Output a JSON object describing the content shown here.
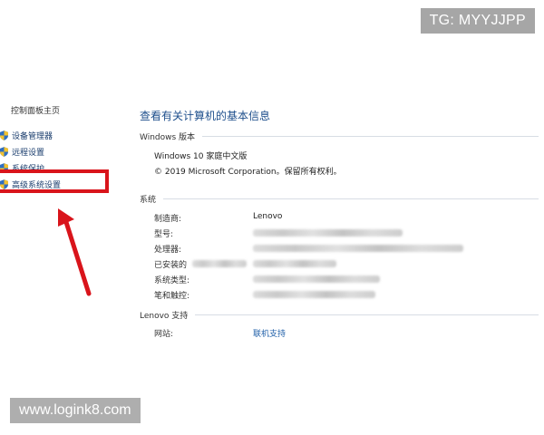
{
  "watermarks": {
    "top": "TG: MYYJJPP",
    "bottom": "www.logink8.com"
  },
  "nav": {
    "title": "控制面板主页",
    "items": [
      {
        "label": "设备管理器",
        "icon": "shield-icon"
      },
      {
        "label": "远程设置",
        "icon": "shield-icon"
      },
      {
        "label": "系统保护",
        "icon": "shield-icon"
      },
      {
        "label": "高级系统设置",
        "icon": "shield-icon"
      }
    ]
  },
  "highlight": {
    "box_color": "#d9141b",
    "arrow_color": "#d9141b"
  },
  "main": {
    "title": "查看有关计算机的基本信息",
    "windows_section": {
      "header": "Windows 版本",
      "edition": "Windows 10 家庭中文版",
      "copyright": "© 2019 Microsoft Corporation。保留所有权利。"
    },
    "system_section": {
      "header": "系统",
      "rows": [
        {
          "label": "制造商:",
          "value": "Lenovo"
        },
        {
          "label": "型号:",
          "value": ""
        },
        {
          "label": "处理器:",
          "value": ""
        },
        {
          "label": "已安装的",
          "value": ""
        },
        {
          "label": "系统类型:",
          "value": ""
        },
        {
          "label": "笔和触控:",
          "value": ""
        }
      ]
    },
    "support_section": {
      "header": "Lenovo 支持",
      "website_label": "网站:",
      "website_link": "联机支持"
    }
  },
  "colors": {
    "title_blue": "#1e4f8c",
    "link_blue": "#1f5fa8",
    "red": "#d9141b"
  }
}
